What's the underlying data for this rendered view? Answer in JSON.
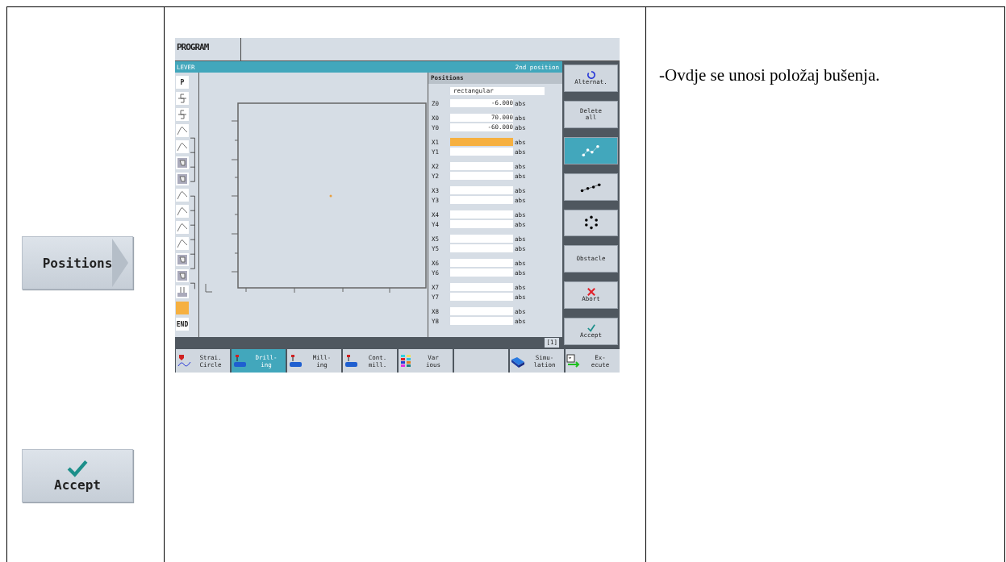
{
  "left_column": {
    "buttons": [
      {
        "label": "Positions",
        "kind": "arrow"
      },
      {
        "label": "Accept",
        "kind": "check"
      }
    ]
  },
  "screen": {
    "header_tab": "PROGRAM",
    "title_left": "LEVER",
    "title_right": "2nd position",
    "program_steps": [
      {
        "kind": "text",
        "label": "P",
        "selected": false
      },
      {
        "kind": "thread",
        "selected": false
      },
      {
        "kind": "thread",
        "selected": false
      },
      {
        "kind": "arc",
        "selected": false
      },
      {
        "kind": "arc",
        "selected": false
      },
      {
        "kind": "pocket",
        "selected": false
      },
      {
        "kind": "pocket",
        "selected": false
      },
      {
        "kind": "arc",
        "selected": false
      },
      {
        "kind": "arc",
        "selected": false
      },
      {
        "kind": "arc",
        "selected": false
      },
      {
        "kind": "arc",
        "selected": false
      },
      {
        "kind": "pocket",
        "selected": false
      },
      {
        "kind": "pocket",
        "selected": false
      },
      {
        "kind": "drill",
        "selected": false
      },
      {
        "kind": "blank",
        "selected": true
      },
      {
        "kind": "text",
        "label": "END",
        "selected": false
      }
    ],
    "positions": {
      "title": "Positions",
      "pattern": "rectangular",
      "groups": [
        {
          "rows": [
            {
              "label": "Z0",
              "value": "-6.000",
              "unit": "abs",
              "selected": false
            }
          ]
        },
        {
          "rows": [
            {
              "label": "X0",
              "value": "70.000",
              "unit": "abs",
              "selected": false
            },
            {
              "label": "Y0",
              "value": "-60.000",
              "unit": "abs",
              "selected": false
            }
          ]
        },
        {
          "rows": [
            {
              "label": "X1",
              "unit": "abs",
              "selected": true
            },
            {
              "label": "Y1",
              "unit": "abs",
              "selected": false
            }
          ]
        },
        {
          "rows": [
            {
              "label": "X2",
              "unit": "abs",
              "selected": false
            },
            {
              "label": "Y2",
              "unit": "abs",
              "selected": false
            }
          ]
        },
        {
          "rows": [
            {
              "label": "X3",
              "unit": "abs",
              "selected": false
            },
            {
              "label": "Y3",
              "unit": "abs",
              "selected": false
            }
          ]
        },
        {
          "rows": [
            {
              "label": "X4",
              "unit": "abs",
              "selected": false
            },
            {
              "label": "Y4",
              "unit": "abs",
              "selected": false
            }
          ]
        },
        {
          "rows": [
            {
              "label": "X5",
              "unit": "abs",
              "selected": false
            },
            {
              "label": "Y5",
              "unit": "abs",
              "selected": false
            }
          ]
        },
        {
          "rows": [
            {
              "label": "X6",
              "unit": "abs",
              "selected": false
            },
            {
              "label": "Y6",
              "unit": "abs",
              "selected": false
            }
          ]
        },
        {
          "rows": [
            {
              "label": "X7",
              "unit": "abs",
              "selected": false
            },
            {
              "label": "Y7",
              "unit": "abs",
              "selected": false
            }
          ]
        },
        {
          "rows": [
            {
              "label": "X8",
              "unit": "abs",
              "selected": false
            },
            {
              "label": "Y8",
              "unit": "abs",
              "selected": false
            }
          ]
        }
      ]
    },
    "page_indicator": "[1]",
    "side_buttons": [
      {
        "kind": "alternate",
        "label": "Alternat.",
        "selected": false
      },
      {
        "kind": "text",
        "label": "Delete\nall",
        "selected": false
      },
      {
        "kind": "pattern_scatter",
        "selected": true
      },
      {
        "kind": "pattern_line",
        "selected": false
      },
      {
        "kind": "pattern_circle",
        "selected": false
      },
      {
        "kind": "text",
        "label": "Obstacle",
        "selected": false
      },
      {
        "kind": "abort",
        "label": "Abort",
        "selected": false
      },
      {
        "kind": "accept",
        "label": "Accept",
        "selected": false
      }
    ],
    "softkeys": [
      {
        "kind": "line_circle",
        "label": "Strai.\nCircle",
        "selected": false
      },
      {
        "kind": "drilling",
        "label": "Drill-\ning",
        "selected": true
      },
      {
        "kind": "milling",
        "label": "Mill-\ning",
        "selected": false
      },
      {
        "kind": "contour",
        "label": "Cont.\nmill.",
        "selected": false
      },
      {
        "kind": "various",
        "label": "Var\nious",
        "selected": false
      },
      {
        "kind": "empty",
        "selected": false
      },
      {
        "kind": "simulation",
        "label": "Simu-\nlation",
        "selected": false
      },
      {
        "kind": "execute",
        "label": "Ex-\necute",
        "selected": false
      }
    ]
  },
  "description": "-Ovdje se unosi položaj bušenja."
}
